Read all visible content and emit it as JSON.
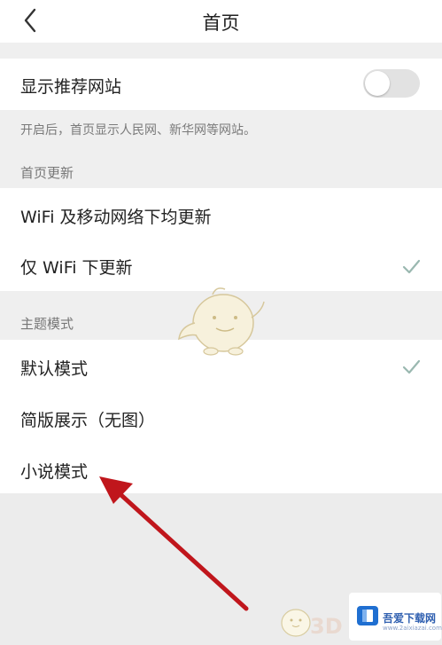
{
  "header": {
    "title": "首页",
    "back_icon": "chevron-left-icon"
  },
  "recommend": {
    "label": "显示推荐网站",
    "toggle_on": false,
    "hint": "开启后，首页显示人民网、新华网等网站。"
  },
  "update_section": {
    "title": "首页更新",
    "options": [
      {
        "label": "WiFi 及移动网络下均更新",
        "selected": false
      },
      {
        "label": "仅 WiFi 下更新",
        "selected": true
      }
    ]
  },
  "theme_section": {
    "title": "主题模式",
    "options": [
      {
        "label": "默认模式",
        "selected": true
      },
      {
        "label": "简版展示（无图）",
        "selected": false
      },
      {
        "label": "小说模式",
        "selected": false
      }
    ]
  },
  "annotation": {
    "arrow_color": "#c0161c"
  },
  "watermark": {
    "name": "吾爱下载网",
    "sub": "www.2aixiazai.com",
    "text_3d": "3D"
  },
  "colors": {
    "check": "#9ab8b0",
    "toggle_off": "#e2e2e2"
  }
}
